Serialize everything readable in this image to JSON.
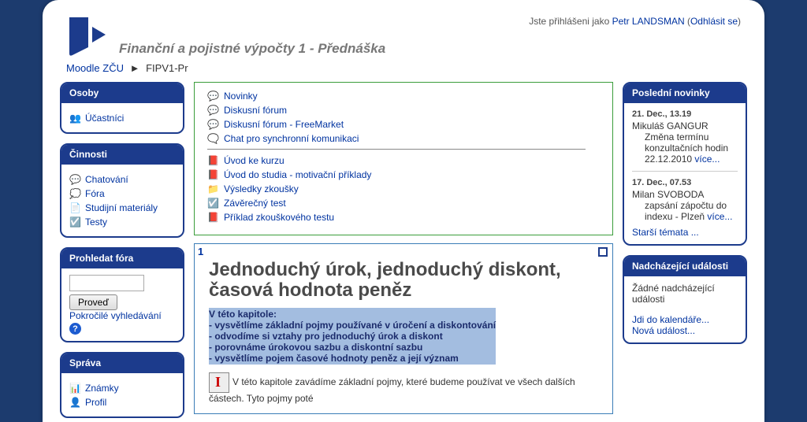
{
  "login": {
    "prefix": "Jste přihlášeni jako ",
    "user": "Petr LANDSMAN",
    "logout": "Odhlásit se"
  },
  "course_title": "Finanční a pojistné výpočty 1 - Přednáška",
  "breadcrumb": {
    "root": "Moodle ZČU",
    "sep": "►",
    "current": "FIPV1-Pr"
  },
  "left": {
    "osoby": {
      "title": "Osoby",
      "item": "Účastníci"
    },
    "cinnosti": {
      "title": "Činnosti",
      "items": [
        "Chatování",
        "Fóra",
        "Studijní materiály",
        "Testy"
      ]
    },
    "search": {
      "title": "Prohledat fóra",
      "btn": "Proveď",
      "adv": "Pokročilé vyhledávání",
      "placeholder": ""
    },
    "sprava": {
      "title": "Správa",
      "items": [
        "Známky",
        "Profil"
      ]
    }
  },
  "mid": {
    "top": [
      "Novinky",
      "Diskusní fórum",
      "Diskusní fórum - FreeMarket",
      "Chat pro synchronní komunikaci"
    ],
    "course": [
      "Úvod ke kurzu",
      "Úvod do studia - motivační příklady",
      "Výsledky zkoušky",
      "Závěrečný test",
      "Příklad zkouškového testu"
    ],
    "section": {
      "num": "1",
      "title": "Jednoduchý úrok, jednoduchý diskont, časová hodnota peněz",
      "hi_lead": "V této kapitole:",
      "hi": [
        "- vysvětlíme základní pojmy používané v úročení a diskontování",
        "- odvodíme si vztahy pro jednoduchý úrok a diskont",
        "- porovnáme úrokovou sazbu a diskontní sazbu",
        "- vysvětlíme pojem časové hodnoty peněz a její význam"
      ],
      "intro": "V této kapitole zavádíme základní pojmy, které budeme používat ve všech dalších částech. Tyto pojmy poté"
    }
  },
  "right": {
    "news": {
      "title": "Poslední novinky",
      "items": [
        {
          "date": "21. Dec., 13.19",
          "author": "Mikuláš GANGUR",
          "text": "Změna termínu konzultačních hodin 22.12.2010 ",
          "more": "více..."
        },
        {
          "date": "17. Dec., 07.53",
          "author": "Milan SVOBODA",
          "text": "zapsání zápočtu do indexu - Plzeň ",
          "more": "více..."
        }
      ],
      "older": "Starší témata ..."
    },
    "events": {
      "title": "Nadcházející události",
      "none": "Žádné nadcházející události",
      "cal": "Jdi do kalendáře...",
      "new": "Nová událost..."
    }
  }
}
